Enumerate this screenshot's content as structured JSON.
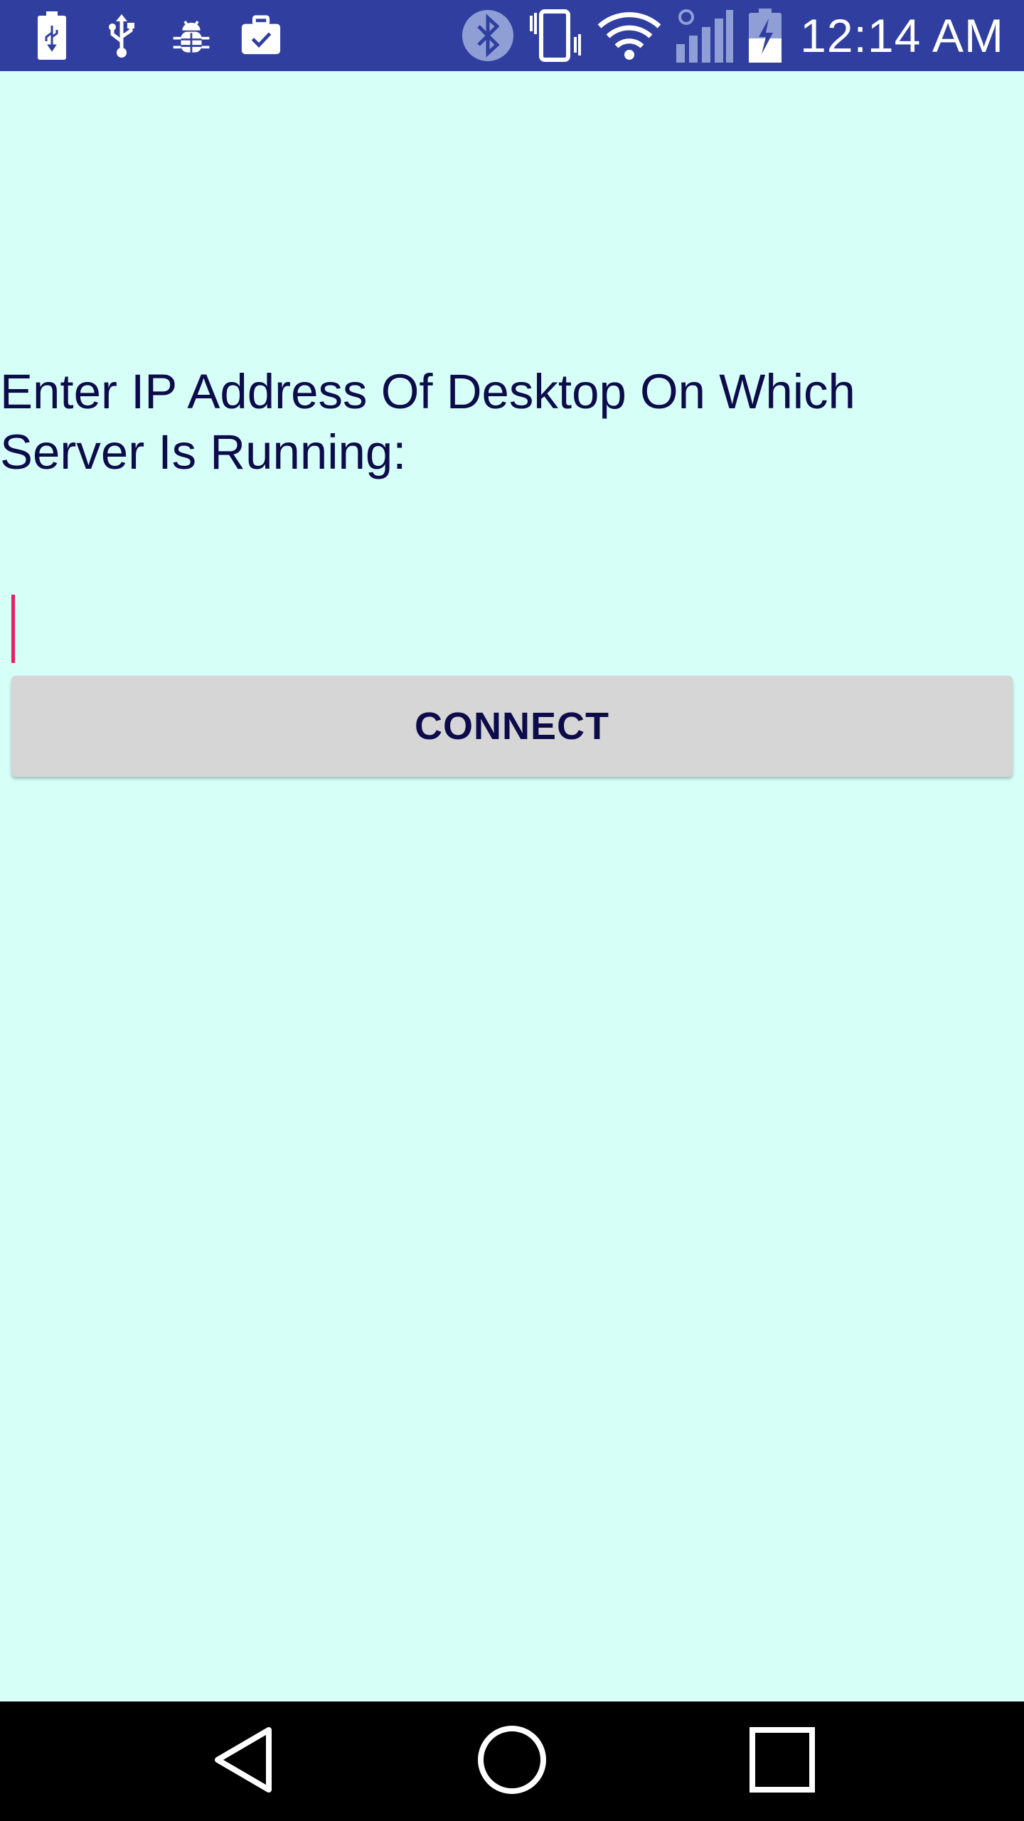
{
  "status_bar": {
    "time": "12:14 AM",
    "background_color": "#303f9f",
    "left_icons": [
      "battery-usb-icon",
      "usb-icon",
      "bug-icon",
      "briefcase-check-icon"
    ],
    "right_icons": [
      "bluetooth-icon",
      "vibrate-icon",
      "wifi-icon",
      "cell-signal-icon",
      "battery-charging-icon"
    ]
  },
  "main": {
    "background_color": "#d6fff8",
    "prompt_label": "Enter IP Address Of Desktop On Which Server Is Running:",
    "ip_input": {
      "value": "",
      "placeholder": ""
    },
    "connect_button_label": "CONNECT",
    "text_color": "#0d0b4a",
    "accent_color": "#e91e63"
  },
  "nav_bar": {
    "buttons": [
      "back-icon",
      "home-icon",
      "recents-icon"
    ]
  }
}
